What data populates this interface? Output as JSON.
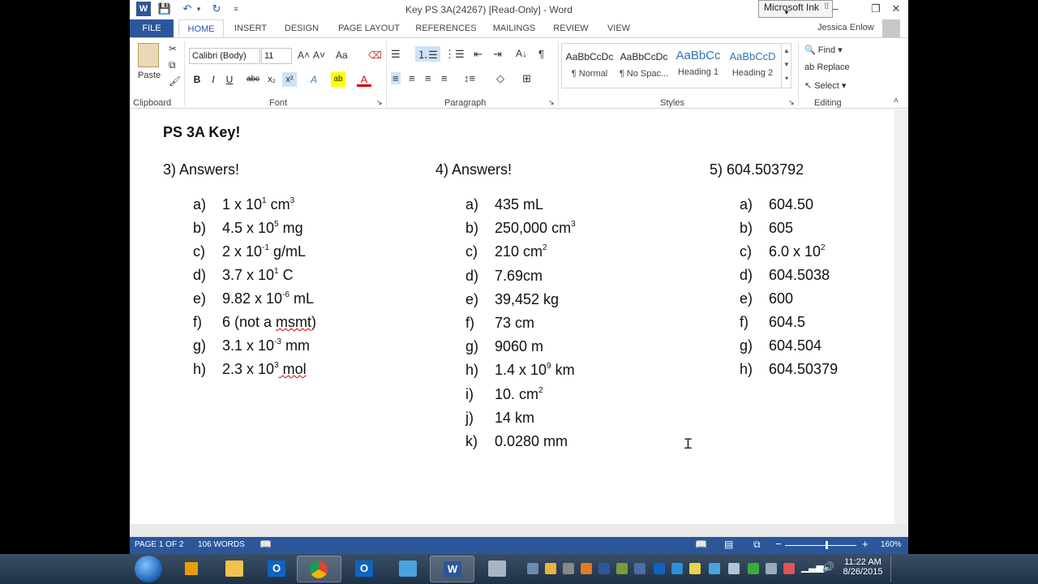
{
  "window": {
    "title": "Key PS 3A(24267) [Read-Only] - Word",
    "microsoft_ink": "Microsoft Ink",
    "controls": {
      "help": "?",
      "restore": "⧉",
      "minimize": "–",
      "maximize": "❐",
      "close": "✕"
    }
  },
  "tabs": [
    "FILE",
    "HOME",
    "INSERT",
    "DESIGN",
    "PAGE LAYOUT",
    "REFERENCES",
    "MAILINGS",
    "REVIEW",
    "VIEW"
  ],
  "user": "Jessica Enlow",
  "ribbon": {
    "clipboard": {
      "paste": "Paste",
      "label": "Clipboard"
    },
    "font": {
      "name": "Calibri (Body)",
      "size": "11",
      "label": "Font",
      "grow": "A˄",
      "shrink": "A˅",
      "case": "Aa",
      "bold": "B",
      "italic": "I",
      "underline": "U",
      "strike": "abc",
      "subscript": "x₂",
      "superscript": "x²",
      "effects": "A",
      "highlight": "ab",
      "color": "A"
    },
    "paragraph": {
      "label": "Paragraph",
      "pilcrow": "¶",
      "sort": "A↓"
    },
    "styles": {
      "label": "Styles",
      "items": [
        {
          "preview": "AaBbCcDc",
          "name": "¶ Normal"
        },
        {
          "preview": "AaBbCcDc",
          "name": "¶ No Spac..."
        },
        {
          "preview": "AaBbCc",
          "name": "Heading 1"
        },
        {
          "preview": "AaBbCcD",
          "name": "Heading 2"
        }
      ]
    },
    "editing": {
      "label": "Editing",
      "find": "Find",
      "replace": "Replace",
      "select": "Select"
    }
  },
  "document": {
    "heading": "PS 3A Key!",
    "col3": {
      "title": "3) Answers!",
      "items": [
        {
          "letter": "a)",
          "pre": "1 x 10",
          "sup": "1",
          "post": " cm",
          "sup2": "3"
        },
        {
          "letter": "b)",
          "pre": "4.5 x 10",
          "sup": "5",
          "post": " mg",
          "sup2": ""
        },
        {
          "letter": "c)",
          "pre": "2 x 10",
          "sup": "-1",
          "post": " g/mL",
          "sup2": ""
        },
        {
          "letter": "d)",
          "pre": "3.7 x 10",
          "sup": "1",
          "post": "  C",
          "sup2": ""
        },
        {
          "letter": "e)",
          "pre": "9.82 x 10",
          "sup": "-6",
          "post": " mL",
          "sup2": ""
        },
        {
          "letter": "f)",
          "pre": "6 (not a ",
          "sup": "",
          "post": "msmt",
          "sup2": "",
          "tail": ")"
        },
        {
          "letter": "g)",
          "pre": "3.1 x 10",
          "sup": "-3",
          "post": " mm",
          "sup2": ""
        },
        {
          "letter": "h)",
          "pre": "2.3 x 10",
          "sup": "3",
          "post": " mol",
          "sup2": ""
        }
      ]
    },
    "col4": {
      "title": "4) Answers!",
      "items": [
        {
          "letter": "a)",
          "text": "435 mL",
          "sup": ""
        },
        {
          "letter": "b)",
          "text": "250,000 cm",
          "sup": "3"
        },
        {
          "letter": "c)",
          "text": "210 cm",
          "sup": "2"
        },
        {
          "letter": "d)",
          "text": "7.69cm",
          "sup": ""
        },
        {
          "letter": "e)",
          "text": "39,452 kg",
          "sup": ""
        },
        {
          "letter": "f)",
          "text": "73 cm",
          "sup": ""
        },
        {
          "letter": "g)",
          "text": "9060 m",
          "sup": ""
        },
        {
          "letter": "h)",
          "text": "1.4 x 10",
          "sup": "9",
          "post": " km"
        },
        {
          "letter": "i)",
          "text": "10. cm",
          "sup": "2"
        },
        {
          "letter": "j)",
          "text": "14 km",
          "sup": ""
        },
        {
          "letter": "k)",
          "text": "0.0280 mm",
          "sup": ""
        }
      ]
    },
    "col5": {
      "title": "5) 604.503792",
      "items": [
        {
          "letter": "a)",
          "text": "604.50",
          "sup": ""
        },
        {
          "letter": "b)",
          "text": "605",
          "sup": ""
        },
        {
          "letter": "c)",
          "text": "6.0 x 10",
          "sup": "2"
        },
        {
          "letter": "d)",
          "text": "604.5038",
          "sup": ""
        },
        {
          "letter": "e)",
          "text": "600",
          "sup": ""
        },
        {
          "letter": "f)",
          "text": "604.5",
          "sup": ""
        },
        {
          "letter": "g)",
          "text": "604.504",
          "sup": ""
        },
        {
          "letter": "h)",
          "text": "604.50379",
          "sup": ""
        }
      ]
    }
  },
  "status": {
    "page": "PAGE 1 OF 2",
    "words": "106 WORDS",
    "zoom": "160%",
    "zoom_minus": "−",
    "zoom_plus": "+"
  },
  "taskbar": {
    "time": "11:22 AM",
    "date": "8/26/2015"
  },
  "colors": {
    "accent": "#2b579a",
    "spellcheck": "#d00000"
  }
}
